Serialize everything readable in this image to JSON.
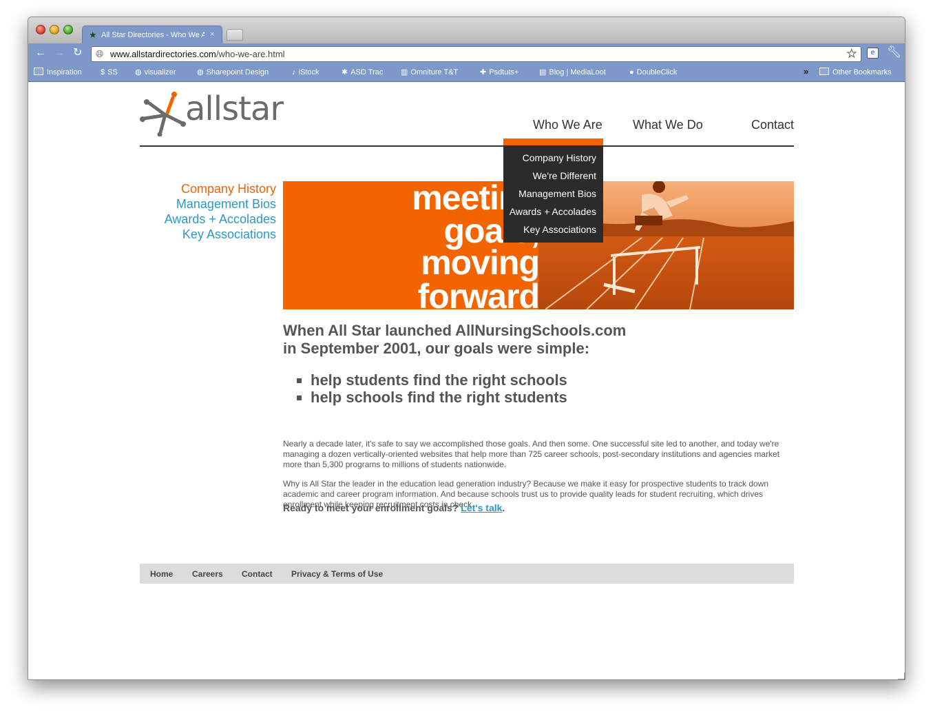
{
  "browser": {
    "tab_title": "All Star Directories - Who We Are",
    "tab_close": "×",
    "url_host": "www.allstardirectories.com",
    "url_path": "/who-we-are.html",
    "icons": {
      "back": "back-arrow-icon",
      "forward": "forward-arrow-icon",
      "reload": "reload-icon",
      "bookmark_star": "star-icon",
      "wrench": "wrench-icon"
    }
  },
  "bookmarks": [
    {
      "label": "Inspiration",
      "icon": "folder-icon"
    },
    {
      "label": "SS",
      "icon": "ss-icon"
    },
    {
      "label": "visualizer",
      "icon": "globe-icon"
    },
    {
      "label": "Sharepoint Design",
      "icon": "globe-icon"
    },
    {
      "label": "iStock",
      "icon": "istock-icon"
    },
    {
      "label": "ASD Trac",
      "icon": "trac-icon"
    },
    {
      "label": "Omniture T&T",
      "icon": "omniture-icon"
    },
    {
      "label": "Psdtuts+",
      "icon": "psdtuts-icon"
    },
    {
      "label": "Blog | MediaLoot",
      "icon": "medialoot-icon"
    },
    {
      "label": "DoubleClick",
      "icon": "doubleclick-icon"
    }
  ],
  "bookmarks_overflow": "»",
  "other_bookmarks": "Other Bookmarks",
  "site": {
    "logo_text": "allstar",
    "brand_orange": "#f26400",
    "link_blue": "#2f97c1",
    "nav": {
      "who": "Who We Are",
      "what": "What We Do",
      "contact": "Contact"
    },
    "dropdown": [
      "Company History",
      "We're Different",
      "Management Bios",
      "Awards + Accolades",
      "Key Associations"
    ],
    "sidenav": [
      "Company History",
      "Management Bios",
      "Awards + Accolades",
      "Key Associations"
    ],
    "hero_words": [
      "meeting",
      "goals,",
      "moving",
      "forward"
    ],
    "intro_line1": "When All Star launched AllNursingSchools.com",
    "intro_line2": "in September 2001, our goals were simple:",
    "bullets": [
      "help students find the right schools",
      "help schools find the right students"
    ],
    "para1": "Nearly a decade later, it's safe to say we accomplished those goals. And then some. One successful site led to another, and today we're managing a dozen vertically-oriented websites that help more than 725 career schools, post-secondary institutions and agencies market more than 5,300 programs to millions of students nationwide.",
    "para2": "Why is All Star the leader in the education lead generation industry? Because we make it easy for prospective students to track down academic and career program information. And because schools trust us to provide quality leads for student recruiting, which drives enrollment while keeping recruitment costs in check.",
    "cta_text": "Ready to meet your enrollment goals? ",
    "cta_link": "Let's talk",
    "cta_end": ".",
    "footer": [
      "Home",
      "Careers",
      "Contact",
      "Privacy & Terms of Use"
    ]
  }
}
